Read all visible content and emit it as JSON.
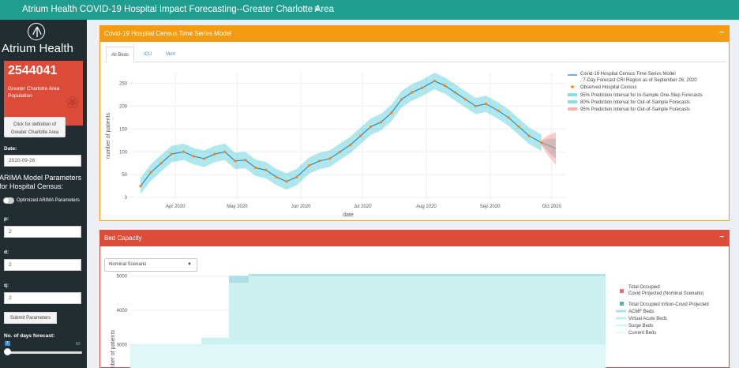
{
  "header": {
    "title": "Atrium Health COVID-19 Hospital Impact Forecasting--Greater Charlotte Area",
    "menu_icon": "≡"
  },
  "sidebar": {
    "logo_text": "Atrium Health",
    "population": {
      "number": "2544041",
      "label": "Greater Charlotte Area Population"
    },
    "definition_button": "Click for definition of Greater Charlotte Area",
    "date_label": "Date:",
    "date_value": "2020-09-26",
    "arima_title": "ARIMA Model Parameters for Hospital Census:",
    "optimized_label": "Optimized ARIMA Parameters",
    "p_label": "p:",
    "p_value": "2",
    "d_label": "d:",
    "d_value": "2",
    "q_label": "q:",
    "q_value": "2",
    "submit_label": "Submit Parameters",
    "forecast_days_label": "No. of days forecast:",
    "slider_min": "7",
    "slider_max": "60"
  },
  "census_box": {
    "title": "Covid-19 Hospital Census Time Series Model",
    "tabs": [
      "All Beds",
      "ICU",
      "Vent"
    ],
    "active_tab": "All Beds"
  },
  "bed_box": {
    "title": "Bed Capacity",
    "scenario": "Nominal Scenario"
  },
  "chart_data": [
    {
      "type": "line",
      "xlabel": "date",
      "ylabel": "number of patients",
      "x_ticks": [
        "Apr 2020",
        "May 2020",
        "Jun 2020",
        "Jul 2020",
        "Aug 2020",
        "Sep 2020",
        "Oct 2020"
      ],
      "y_ticks": [
        0,
        50,
        100,
        150,
        200,
        250
      ],
      "ylim": [
        -5,
        275
      ],
      "grid": true,
      "legend_position": "top-right",
      "colors": {
        "model": "#1f77b4",
        "observed": "#ff7f0e",
        "band_insample": "#17becf",
        "band_80": "#17becf",
        "band_95_oos": "#ff6666",
        "forecast": "#999999"
      },
      "legend": [
        "Covid-19 Hospital Census Time Series Model , 7-Day Forecast CRI Region as of September 26, 2020",
        "Observed Hospital Census",
        "95% Prediction Interval for In-Sample One-Step Forecasts",
        "80% Prediction Interval for Out-of-Sample Forecasts",
        "95% Prediction Interval for Out-of-Sample Forecasts"
      ],
      "series": [
        {
          "name": "Observed Hospital Census",
          "x": [
            "2020-03-15",
            "2020-03-20",
            "2020-03-25",
            "2020-03-30",
            "2020-04-05",
            "2020-04-10",
            "2020-04-15",
            "2020-04-20",
            "2020-04-25",
            "2020-04-30",
            "2020-05-05",
            "2020-05-10",
            "2020-05-15",
            "2020-05-20",
            "2020-05-25",
            "2020-05-30",
            "2020-06-05",
            "2020-06-10",
            "2020-06-15",
            "2020-06-20",
            "2020-06-25",
            "2020-06-30",
            "2020-07-05",
            "2020-07-10",
            "2020-07-15",
            "2020-07-20",
            "2020-07-25",
            "2020-07-30",
            "2020-08-05",
            "2020-08-10",
            "2020-08-15",
            "2020-08-20",
            "2020-08-25",
            "2020-08-30",
            "2020-09-05",
            "2020-09-10",
            "2020-09-15",
            "2020-09-20",
            "2020-09-26"
          ],
          "y": [
            25,
            55,
            75,
            95,
            100,
            90,
            85,
            95,
            100,
            80,
            82,
            65,
            60,
            45,
            35,
            45,
            70,
            80,
            85,
            100,
            115,
            135,
            155,
            165,
            185,
            215,
            230,
            240,
            255,
            245,
            230,
            215,
            200,
            205,
            190,
            175,
            155,
            135,
            120
          ]
        },
        {
          "name": "Covid-19 Hospital Census Time Series Model , 7-Day Forecast CRI Region as of September 26, 2020",
          "x": [
            "2020-09-26",
            "2020-09-29",
            "2020-10-03"
          ],
          "y": [
            120,
            115,
            107
          ]
        }
      ]
    },
    {
      "type": "area",
      "ylabel": "number of patients",
      "y_ticks": [
        3000,
        4000,
        5000
      ],
      "ylim": [
        2800,
        5400
      ],
      "legend_position": "top-right",
      "legend": [
        "Total Occupied Covid Projected (Nominal Scenario)",
        "Total Occupied \\nNon-Covid Projected",
        "ACMF Beds",
        "Virtual Acute Beds",
        "Surge Beds",
        "Current Beds"
      ],
      "series": [
        {
          "name": "Current Beds",
          "values": [
            3000,
            3000,
            3000,
            3000,
            3000,
            3000
          ]
        },
        {
          "name": "Surge Beds",
          "values": [
            3000,
            3200,
            4800,
            5000,
            5000,
            5000
          ]
        },
        {
          "name": "ACMF Beds",
          "values": [
            3000,
            3200,
            5000,
            5200,
            5200,
            5200
          ]
        }
      ]
    }
  ]
}
